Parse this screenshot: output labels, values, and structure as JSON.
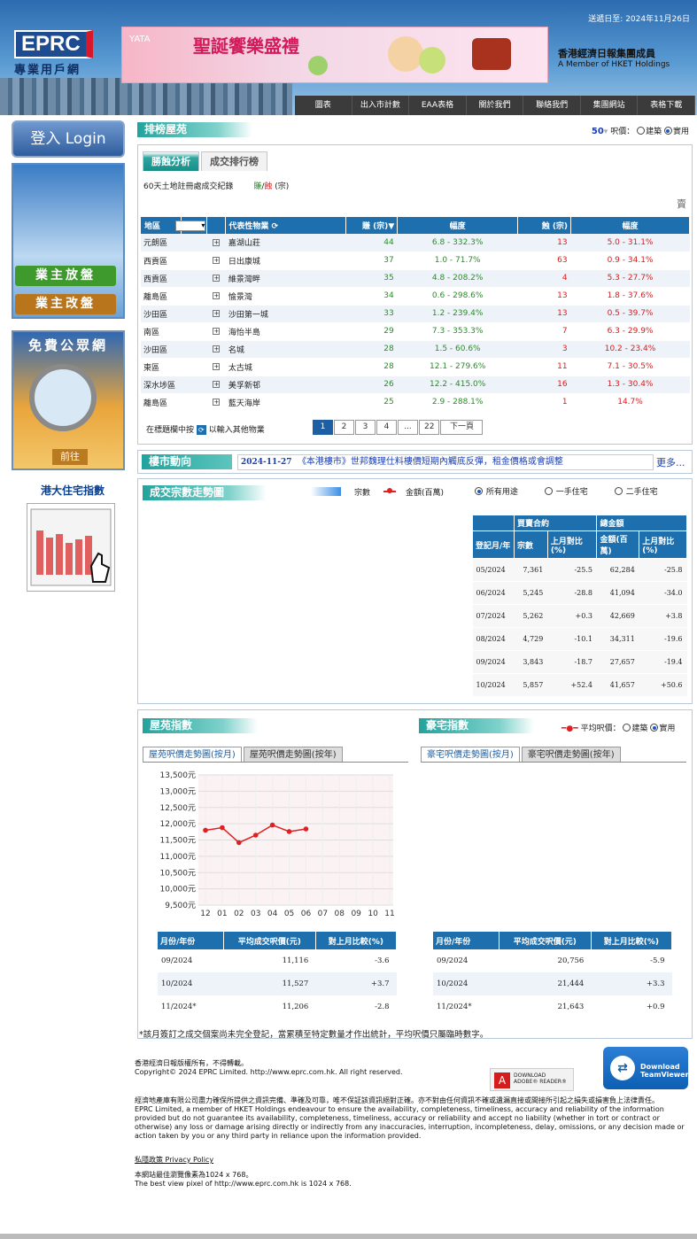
{
  "header": {
    "update_date": "送遞日至: 2024年11月26日",
    "logo_main": "EPRC",
    "logo_sub": "專業用戶網",
    "banner_brand": "YATA",
    "banner_title": "聖誕饗樂盛禮",
    "hket_name": "香港經濟日報集團成員",
    "hket_en": "A Member of HKET Holdings",
    "nav": [
      "圖表",
      "出入市計數",
      "EAA表格",
      "關於我們",
      "聯絡我們",
      "集團網站",
      "表格下載"
    ]
  },
  "sidebar": {
    "login": "登入 Login",
    "owner_list": "業主放盤",
    "owner_change": "業主改盤",
    "free_title": "免費公眾網",
    "free_go": "前往",
    "hku_title": "港大住宅指數"
  },
  "ranking": {
    "title": "排榜屋苑",
    "count": "50",
    "price_label": "呎價：",
    "price_options": [
      "建築",
      "實用"
    ],
    "tabs": [
      "勝蝕分析",
      "成交排行榜"
    ],
    "subtitle": "60天土地註冊處成交紀錄",
    "legend_gain": "賺",
    "legend_sep": "/",
    "legend_loss": "蝕",
    "legend_unit": "(宗)",
    "stray": "賣",
    "columns": [
      "地區",
      "代表性物業",
      "賺 (宗)",
      "幅度",
      "蝕 (宗)",
      "幅度"
    ],
    "rows": [
      {
        "district": "元朗區",
        "estate": "嘉湖山莊",
        "gain": "44",
        "gain_range": "6.8 - 332.3%",
        "loss": "13",
        "loss_range": "5.0 - 31.1%"
      },
      {
        "district": "西貢區",
        "estate": "日出康城",
        "gain": "37",
        "gain_range": "1.0 - 71.7%",
        "loss": "63",
        "loss_range": "0.9 - 34.1%"
      },
      {
        "district": "西貢區",
        "estate": "維景灣畔",
        "gain": "35",
        "gain_range": "4.8 - 208.2%",
        "loss": "4",
        "loss_range": "5.3 - 27.7%"
      },
      {
        "district": "離島區",
        "estate": "愉景灣",
        "gain": "34",
        "gain_range": "0.6 - 298.6%",
        "loss": "13",
        "loss_range": "1.8 - 37.6%"
      },
      {
        "district": "沙田區",
        "estate": "沙田第一城",
        "gain": "33",
        "gain_range": "1.2 - 239.4%",
        "loss": "13",
        "loss_range": "0.5 - 39.7%"
      },
      {
        "district": "南區",
        "estate": "海怡半島",
        "gain": "29",
        "gain_range": "7.3 - 353.3%",
        "loss": "7",
        "loss_range": "6.3 - 29.9%"
      },
      {
        "district": "沙田區",
        "estate": "名城",
        "gain": "28",
        "gain_range": "1.5 - 60.6%",
        "loss": "3",
        "loss_range": "10.2 - 23.4%"
      },
      {
        "district": "東區",
        "estate": "太古城",
        "gain": "28",
        "gain_range": "12.1 - 279.6%",
        "loss": "11",
        "loss_range": "7.1 - 30.5%"
      },
      {
        "district": "深水埗區",
        "estate": "美孚新邨",
        "gain": "26",
        "gain_range": "12.2 - 415.0%",
        "loss": "16",
        "loss_range": "1.3 - 30.4%"
      },
      {
        "district": "離島區",
        "estate": "藍天海岸",
        "gain": "25",
        "gain_range": "2.9 - 288.1%",
        "loss": "1",
        "loss_range": "14.7%"
      }
    ],
    "hint_before": "在標題欄中按",
    "hint_after": "以輸入其他物業",
    "pages": [
      "1",
      "2",
      "3",
      "4",
      "...",
      "22",
      "下一頁"
    ]
  },
  "news": {
    "title": "樓市動向",
    "date": "2024-11-27",
    "headline": "《本港樓市》世邦魏理仕料樓價短期內觸底反彈，租金價格或會調整",
    "more": "更多..."
  },
  "transactions": {
    "title": "成交宗數走勢圖",
    "legend_count": "宗數",
    "legend_amount": "金額(百萬)",
    "usage_options": [
      "所有用途",
      "一手住宅",
      "二手住宅"
    ],
    "header_group1": "買賣合約",
    "header_group2": "總金額",
    "columns": [
      "登記月/年",
      "宗數",
      "上月對比(%)",
      "金額(百萬)",
      "上月對比(%)"
    ],
    "rows": [
      [
        "05/2024",
        "7,361",
        "-25.5",
        "62,284",
        "-25.8"
      ],
      [
        "06/2024",
        "5,245",
        "-28.8",
        "41,094",
        "-34.0"
      ],
      [
        "07/2024",
        "5,262",
        "+0.3",
        "42,669",
        "+3.8"
      ],
      [
        "08/2024",
        "4,729",
        "-10.1",
        "34,311",
        "-19.6"
      ],
      [
        "09/2024",
        "3,843",
        "-18.7",
        "27,657",
        "-19.4"
      ],
      [
        "10/2024",
        "5,857",
        "+52.4",
        "41,657",
        "+50.6"
      ]
    ]
  },
  "estate_index": {
    "title": "屋苑指數",
    "tabs": [
      "屋苑呎價走勢圖(按月)",
      "屋苑呎價走勢圖(按年)"
    ],
    "columns": [
      "月份/年份",
      "平均成交呎價(元)",
      "對上月比較(%)"
    ],
    "rows": [
      [
        "09/2024",
        "11,116",
        "-3.6"
      ],
      [
        "10/2024",
        "11,527",
        "+3.7"
      ],
      [
        "11/2024*",
        "11,206",
        "-2.8"
      ]
    ]
  },
  "luxury_index": {
    "title": "豪宅指數",
    "avg_label": "平均呎價：",
    "price_options": [
      "建築",
      "實用"
    ],
    "tabs": [
      "豪宅呎價走勢圖(按月)",
      "豪宅呎價走勢圖(按年)"
    ],
    "columns": [
      "月份/年份",
      "平均成交呎價(元)",
      "對上月比較(%)"
    ],
    "rows": [
      [
        "09/2024",
        "20,756",
        "-5.9"
      ],
      [
        "10/2024",
        "21,444",
        "+3.3"
      ],
      [
        "11/2024*",
        "21,643",
        "+0.9"
      ]
    ]
  },
  "chart_data": {
    "type": "line",
    "title": "",
    "xlabel": "",
    "ylabel": "",
    "x": [
      "12",
      "01",
      "02",
      "03",
      "04",
      "05",
      "06",
      "07",
      "08",
      "09",
      "10",
      "11"
    ],
    "series": [
      {
        "values": [
          11800,
          11880,
          11420,
          11650,
          11960,
          11760,
          11840,
          null,
          null,
          null,
          null,
          null
        ]
      }
    ],
    "ylim": [
      9500,
      13500
    ],
    "yticks": [
      "9,500元",
      "10,000元",
      "10,500元",
      "11,000元",
      "11,500元",
      "12,000元",
      "12,500元",
      "13,000元",
      "13,500元"
    ],
    "grid": true,
    "color": "#e02020"
  },
  "note": "*該月簽訂之成交個案尚未完全登記，當累積至特定數量才作出統計，平均呎價只屬臨時數字。",
  "footer": {
    "line1": "香港經濟日報版權所有，不得轉載。",
    "line2": "Copyright© 2024 EPRC Limited. http://www.eprc.com.hk. All right reserved.",
    "disclaimer_zh": "經濟地產庫有限公司盡力確保所提供之資訊完備、準確及可靠，唯不保証該資訊絕對正確。亦不對由任何資訊不確或遺漏直接或間接所引起之損失或損害負上法律責任。",
    "disclaimer_en": "EPRC Limited, a member of HKET Holdings endeavour to ensure the availability, completeness, timeliness, accuracy and reliability of the information provided but do not guarantee its availability, completeness, timeliness, accuracy or reliability and accept no liability (whether in tort or contract or otherwise) any loss or damage arising directly or indirectly from any inaccuracies, interruption, incompleteness, delay, omissions, or any decision made or action taken by you or any third party in reliance upon the information provided.",
    "privacy": "私隱政策 Privacy Policy",
    "best_zh": "本網站最佳瀏覽像素為1024 x 768。",
    "best_en": "The best view pixel of http://www.eprc.com.hk is 1024 x 768.",
    "adobe_line1": "DOWNLOAD",
    "adobe_line2": "ADOBE® READER®",
    "teamviewer_line1": "Download",
    "teamviewer_line2": "TeamViewer"
  }
}
